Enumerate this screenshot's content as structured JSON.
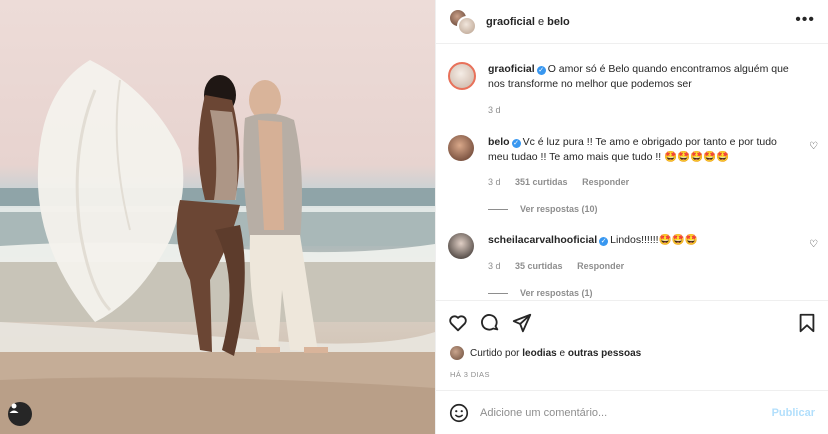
{
  "header": {
    "user1": "graoficial",
    "conj": "e",
    "user2": "belo",
    "more_icon": "more-horizontal-icon"
  },
  "caption": {
    "username": "graoficial",
    "text": "O amor só é Belo quando encontramos alguém que nos transforme no melhor que podemos ser",
    "time": "3 d"
  },
  "comments": [
    {
      "username": "belo",
      "text": "Vc é luz pura !! Te amo e obrigado por tanto e por tudo meu tudao !! Te amo mais que tudo !! 🤩🤩🤩🤩🤩",
      "time": "3 d",
      "likes": "351 curtidas",
      "reply": "Responder",
      "replies": "Ver respostas (10)"
    },
    {
      "username": "scheilacarvalhooficial",
      "text": "Lindos!!!!!!🤩🤩🤩",
      "time": "3 d",
      "likes": "35 curtidas",
      "reply": "Responder",
      "replies": "Ver respostas (1)"
    }
  ],
  "likes": {
    "prefix": "Curtido por",
    "user": "leodias",
    "suffix": "e",
    "others": "outras pessoas"
  },
  "posted_ago": "HÁ 3 DIAS",
  "add_comment": {
    "placeholder": "Adicione um comentário...",
    "publish": "Publicar"
  },
  "colors": {
    "text": "#262626",
    "secondary": "#8e8e8e",
    "verified": "#3897f0",
    "publish_disabled": "#b2dffc",
    "border": "#efefef"
  }
}
